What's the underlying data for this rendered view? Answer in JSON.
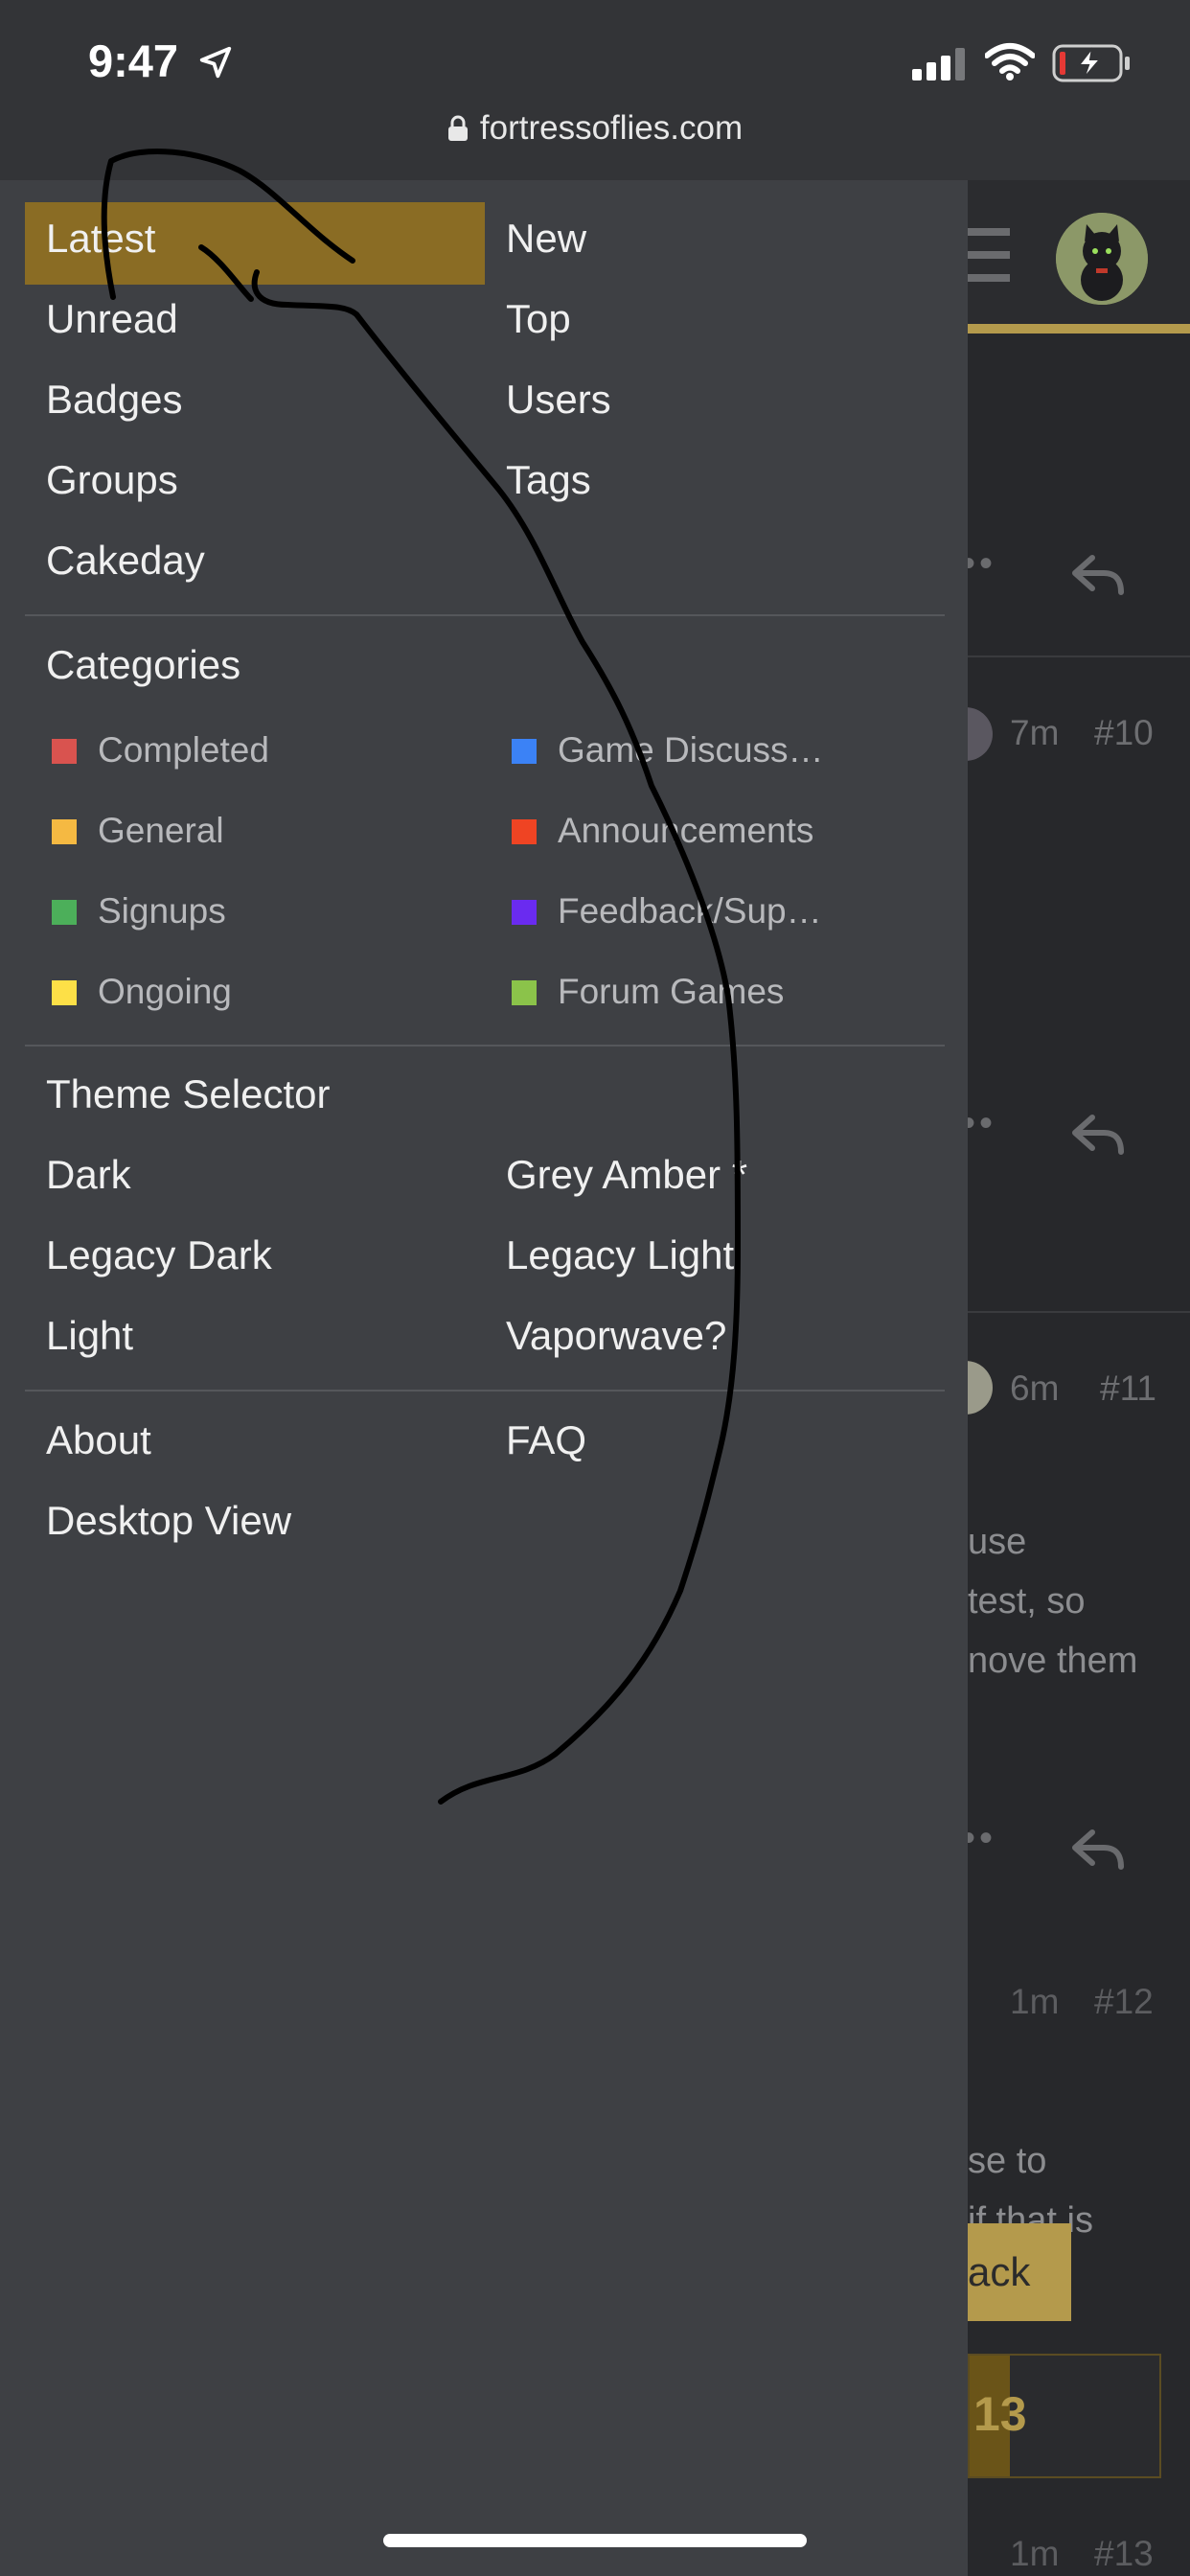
{
  "status_bar": {
    "time": "9:47",
    "url": "fortressoflies.com",
    "icons": [
      "location-arrow-icon",
      "signal-icon",
      "wifi-icon",
      "battery-charging-icon"
    ]
  },
  "menu": {
    "primary": [
      {
        "label": "Latest",
        "active": true
      },
      {
        "label": "New"
      },
      {
        "label": "Unread"
      },
      {
        "label": "Top"
      },
      {
        "label": "Badges"
      },
      {
        "label": "Users"
      },
      {
        "label": "Groups"
      },
      {
        "label": "Tags"
      },
      {
        "label": "Cakeday"
      }
    ],
    "categories_title": "Categories",
    "categories": [
      {
        "label": "Completed",
        "color": "#d9534f"
      },
      {
        "label": "Game Discuss…",
        "color": "#3b82f6"
      },
      {
        "label": "General",
        "color": "#f5b942"
      },
      {
        "label": "Announcements",
        "color": "#ef4423"
      },
      {
        "label": "Signups",
        "color": "#4caf5a"
      },
      {
        "label": "Feedback/Sup…",
        "color": "#6a2bf0"
      },
      {
        "label": "Ongoing",
        "color": "#fde047"
      },
      {
        "label": "Forum Games",
        "color": "#8bc34a"
      }
    ],
    "theme_title": "Theme Selector",
    "themes": [
      {
        "label": "Dark"
      },
      {
        "label": "Grey Amber *"
      },
      {
        "label": "Legacy Dark"
      },
      {
        "label": "Legacy Light"
      },
      {
        "label": "Light"
      },
      {
        "label": "Vaporwave?"
      }
    ],
    "footer": [
      {
        "label": "About"
      },
      {
        "label": "FAQ"
      },
      {
        "label": "Desktop View"
      }
    ]
  },
  "background_page": {
    "posts": [
      {
        "time": "7m",
        "number": "#10"
      },
      {
        "time": "6m",
        "number": "#11"
      },
      {
        "time": "1m",
        "number": "#12"
      },
      {
        "time": "1m",
        "number": "#13"
      }
    ],
    "text_lines": [
      "use",
      "test, so",
      "nove them",
      "se to",
      "if that is"
    ],
    "back_button": "ack",
    "progress_number": "13"
  },
  "colors": {
    "accent": "#b49a4c",
    "active_item": "#8a6c24",
    "drawer": "#3e4044"
  }
}
